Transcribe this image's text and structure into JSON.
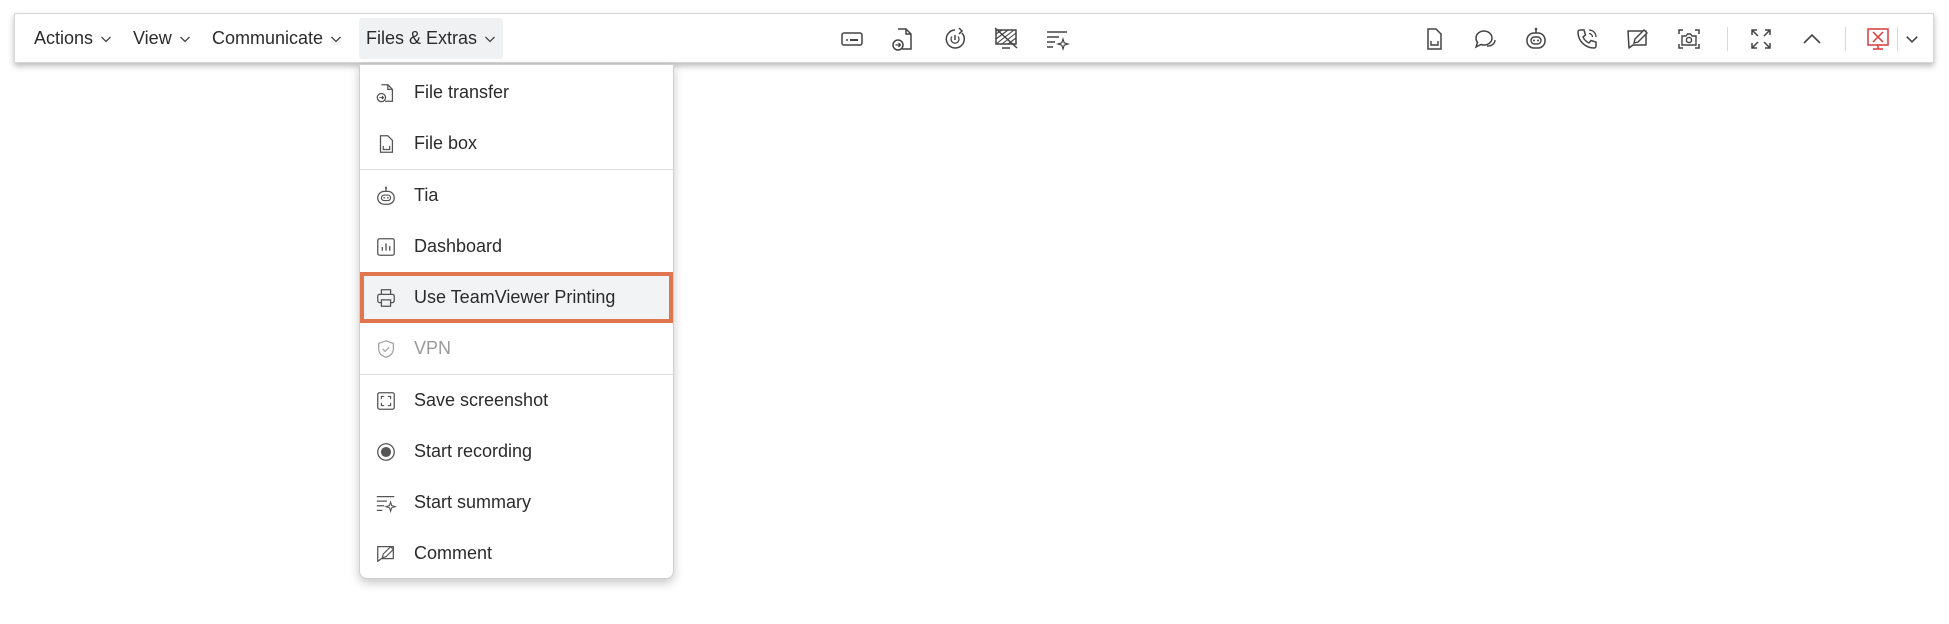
{
  "menubar": {
    "actions": "Actions",
    "view": "View",
    "communicate": "Communicate",
    "files_extras": "Files & Extras"
  },
  "toolbar_icons": {
    "center": [
      "remote-keyboard-icon",
      "file-transfer-icon",
      "power-restart-icon",
      "disable-display-icon",
      "summary-sparkle-icon"
    ],
    "right": [
      "file-box-icon",
      "chat-icon",
      "tia-robot-icon",
      "call-icon",
      "comment-edit-icon",
      "camera-screenshot-icon",
      "fullscreen-icon",
      "collapse-icon",
      "end-session-icon",
      "end-session-options-icon"
    ]
  },
  "dropdown": {
    "items": [
      {
        "label": "File transfer",
        "icon": "file-transfer-icon",
        "state": "normal"
      },
      {
        "label": "File box",
        "icon": "file-box-icon",
        "state": "normal"
      },
      {
        "label": "Tia",
        "icon": "robot-icon",
        "state": "normal"
      },
      {
        "label": "Dashboard",
        "icon": "dashboard-icon",
        "state": "normal"
      },
      {
        "label": "Use TeamViewer Printing",
        "icon": "printer-icon",
        "state": "highlighted"
      },
      {
        "label": "VPN",
        "icon": "shield-check-icon",
        "state": "disabled"
      },
      {
        "label": "Save screenshot",
        "icon": "screenshot-frame-icon",
        "state": "normal"
      },
      {
        "label": "Start recording",
        "icon": "record-icon",
        "state": "normal"
      },
      {
        "label": "Start summary",
        "icon": "summary-sparkle-icon",
        "state": "normal"
      },
      {
        "label": "Comment",
        "icon": "comment-edit-icon",
        "state": "normal"
      }
    ]
  },
  "colors": {
    "highlight_border": "#e07650",
    "end_session_red": "#d93a3a",
    "text": "#2b2b2b",
    "disabled_text": "#9a9a9a"
  }
}
